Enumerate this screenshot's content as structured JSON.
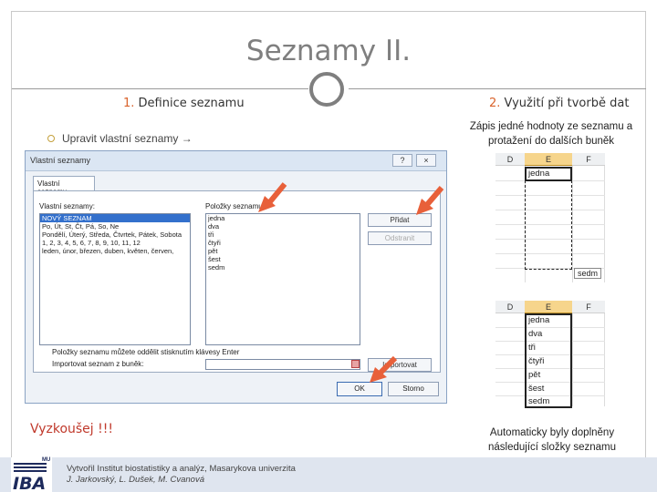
{
  "slide": {
    "title": "Seznamy II.",
    "sections": {
      "left": {
        "number": "1.",
        "label": "Definice seznamu"
      },
      "right": {
        "number": "2.",
        "label": "Využití při tvorbě dat"
      }
    },
    "bullet": "Upravit vlastní seznamy →",
    "try_it": "Vyzkoušej !!!",
    "desc_top": [
      "Zápis jedné hodnoty ze seznamu a",
      "protažení do dalších buněk"
    ],
    "desc_bottom": [
      "Automaticky byly doplněny",
      "následující složky seznamu"
    ]
  },
  "dialog": {
    "title": "Vlastní seznamy",
    "help": "?",
    "close": "×",
    "tab": "Vlastní seznamy",
    "lists_label": "Vlastní seznamy:",
    "lists": [
      "NOVÝ SEZNAM",
      "Po, Út, St, Čt, Pá, So, Ne",
      "Pondělí, Úterý, Středa, Čtvrtek, Pátek, Sobota",
      "1, 2, 3, 4, 5, 6, 7, 8, 9, 10, 11, 12",
      "leden, únor, březen, duben, květen, červen,"
    ],
    "entries_label": "Položky seznamu:",
    "entries": [
      "jedna",
      "dva",
      "tři",
      "čtyři",
      "pět",
      "šest",
      "sedm"
    ],
    "add_button": "Přidat",
    "delete_button": "Odstranit",
    "separator_note": "Položky seznamu můžete oddělit stisknutím klávesy Enter",
    "import_label": "Importovat seznam z buněk:",
    "import_button": "Importovat",
    "ok_button": "OK",
    "cancel_button": "Storno"
  },
  "sheet_top": {
    "columns": [
      "D",
      "E",
      "F"
    ],
    "cell": "jedna",
    "tooltip": "sedm"
  },
  "sheet_bottom": {
    "columns": [
      "D",
      "E",
      "F"
    ],
    "cells": [
      "jedna",
      "dva",
      "tři",
      "čtyři",
      "pět",
      "šest",
      "sedm"
    ]
  },
  "footer": {
    "logo": "IBA",
    "logo_mark": "MU",
    "line1": "Vytvořil Institut biostatistiky a analýz, Masarykova univerzita",
    "line2": "J. Jarkovský, L. Dušek, M. Cvanová"
  },
  "colors": {
    "accent": "#d9622b",
    "arrow": "#e8603a",
    "title": "#7f7f7f"
  }
}
